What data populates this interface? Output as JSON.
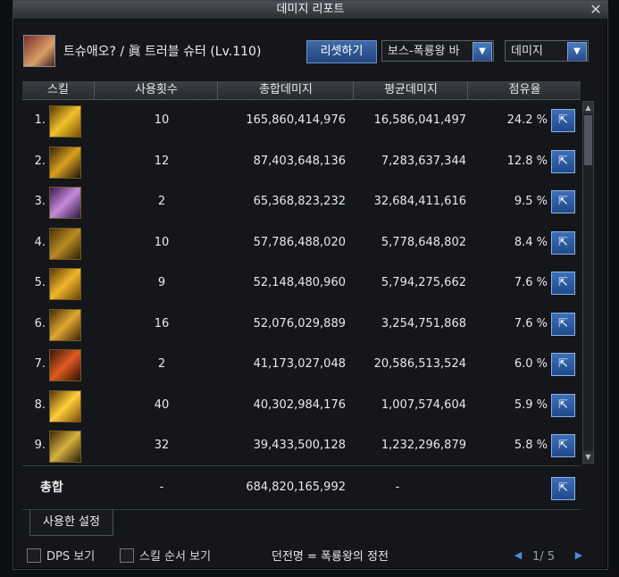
{
  "window": {
    "title": "데미지 리포트"
  },
  "header": {
    "character": "트슈애오? / 眞 트러블 슈터 (Lv.110)",
    "reset_button": "리셋하기",
    "mode_select": "보스-폭룡왕 바",
    "type_select": "데미지"
  },
  "columns": [
    "스킬",
    "사용횟수",
    "총합데미지",
    "평균데미지",
    "점유율"
  ],
  "rows": [
    {
      "rank": "1.",
      "icon": "skill-icon-1",
      "uses": "10",
      "total": "165,860,414,976",
      "avg": "16,586,041,497",
      "share": "24.2 %"
    },
    {
      "rank": "2.",
      "icon": "skill-icon-2",
      "uses": "12",
      "total": "87,403,648,136",
      "avg": "7,283,637,344",
      "share": "12.8 %"
    },
    {
      "rank": "3.",
      "icon": "skill-icon-3",
      "uses": "2",
      "total": "65,368,823,232",
      "avg": "32,684,411,616",
      "share": "9.5 %"
    },
    {
      "rank": "4.",
      "icon": "skill-icon-4",
      "uses": "10",
      "total": "57,786,488,020",
      "avg": "5,778,648,802",
      "share": "8.4 %"
    },
    {
      "rank": "5.",
      "icon": "skill-icon-5",
      "uses": "9",
      "total": "52,148,480,960",
      "avg": "5,794,275,662",
      "share": "7.6 %"
    },
    {
      "rank": "6.",
      "icon": "skill-icon-6",
      "uses": "16",
      "total": "52,076,029,889",
      "avg": "3,254,751,868",
      "share": "7.6 %"
    },
    {
      "rank": "7.",
      "icon": "skill-icon-7",
      "uses": "2",
      "total": "41,173,027,048",
      "avg": "20,586,513,524",
      "share": "6.0 %"
    },
    {
      "rank": "8.",
      "icon": "skill-icon-8",
      "uses": "40",
      "total": "40,302,984,176",
      "avg": "1,007,574,604",
      "share": "5.9 %"
    },
    {
      "rank": "9.",
      "icon": "skill-icon-9",
      "uses": "32",
      "total": "39,433,500,128",
      "avg": "1,232,296,879",
      "share": "5.8 %"
    }
  ],
  "summary": {
    "label": "총합",
    "uses": "-",
    "total": "684,820,165,992",
    "avg": "-"
  },
  "tabs": {
    "settings": "사용한 설정"
  },
  "bottom": {
    "dps_label": "DPS 보기",
    "skill_order_label": "스킬 순서 보기",
    "dungeon": "던전명 = 폭룡왕의 정전",
    "pager": "1/ 5"
  },
  "icons": {
    "share": "share-icon",
    "close": "close-icon",
    "dropdown": "chevron-down-icon"
  },
  "colors": {
    "accent": "#3c6fb8",
    "header_bg": "#2c2f34",
    "panel_bg": "#141619"
  }
}
